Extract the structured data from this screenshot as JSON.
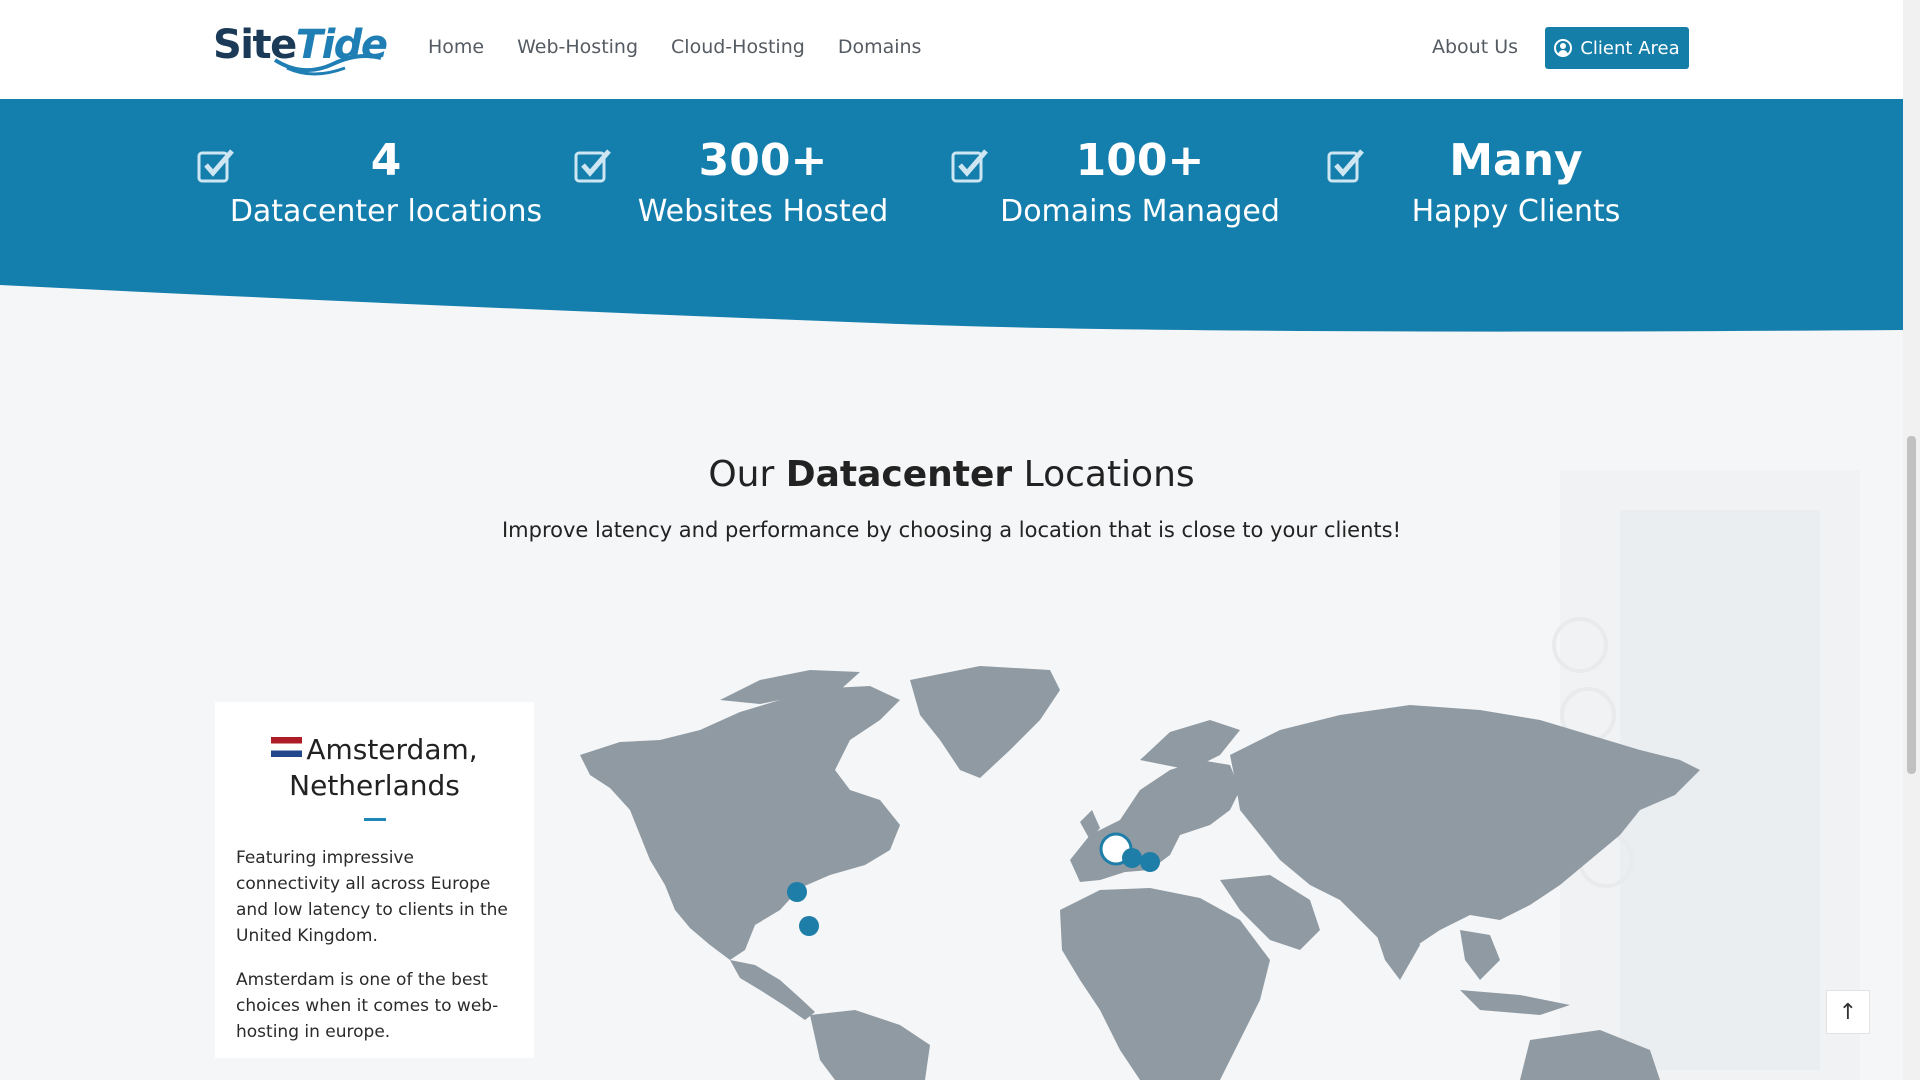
{
  "header": {
    "logo": {
      "site": "Site",
      "tide": "Tide"
    },
    "nav": [
      "Home",
      "Web-Hosting",
      "Cloud-Hosting",
      "Domains"
    ],
    "about": "About Us",
    "client_area": "Client Area"
  },
  "stats": [
    {
      "number": "4",
      "label": "Datacenter locations"
    },
    {
      "number": "300+",
      "label": "Websites Hosted"
    },
    {
      "number": "100+",
      "label": "Domains Managed"
    },
    {
      "number": "Many",
      "label": "Happy Clients"
    }
  ],
  "locations": {
    "title_prefix": "Our",
    "title_bold": "Datacenter",
    "title_suffix": "Locations",
    "subtitle": "Improve latency and performance by choosing a location that is close to your clients!"
  },
  "card": {
    "title_line1": "Amsterdam,",
    "title_line2": "Netherlands",
    "para1": "Featuring impressive connectivity all across Europe and low latency to clients in the United Kingdom.",
    "para2": "Amsterdam is one of the best choices when it comes to web-hosting in europe."
  },
  "to_top": "↑",
  "colors": {
    "accent": "#147ea8",
    "band": "#147ead",
    "map": "#8f9aa3",
    "marker": "#1f7ea8"
  }
}
